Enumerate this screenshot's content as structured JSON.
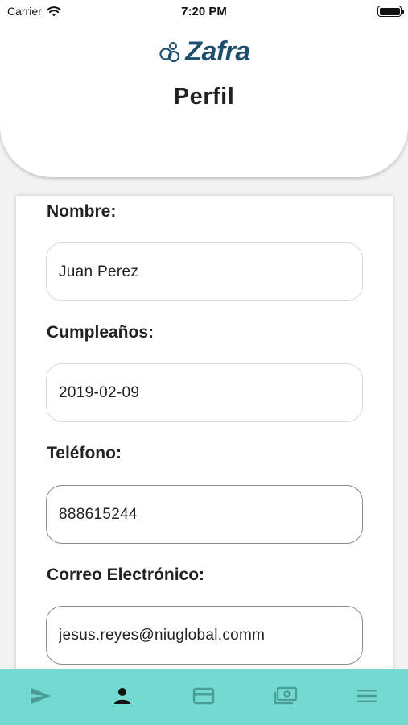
{
  "status_bar": {
    "carrier": "Carrier",
    "time": "7:20 PM",
    "battery_level": 1.0
  },
  "header": {
    "logo_text": "Zafra",
    "title": "Perfil"
  },
  "form": {
    "fields": [
      {
        "label": "Nombre:",
        "value": "Juan Perez"
      },
      {
        "label": "Cumpleaños:",
        "value": "2019-02-09"
      },
      {
        "label": "Teléfono:",
        "value": "888615244"
      },
      {
        "label": "Correo Electrónico:",
        "value": "jesus.reyes@niuglobal.comm"
      }
    ]
  },
  "tabbar": {
    "tabs": [
      {
        "icon": "send-icon",
        "active": false
      },
      {
        "icon": "person-icon",
        "active": true
      },
      {
        "icon": "credit-card-icon",
        "active": false
      },
      {
        "icon": "money-icon",
        "active": false
      },
      {
        "icon": "menu-icon",
        "active": false
      }
    ]
  },
  "colors": {
    "tabbar_bg": "#74d9d1",
    "tab_icon_inactive": "#4b9c95",
    "tab_icon_active": "#111111",
    "logo_blue": "#1d4e6b",
    "page_bg": "#f3f3f3"
  }
}
